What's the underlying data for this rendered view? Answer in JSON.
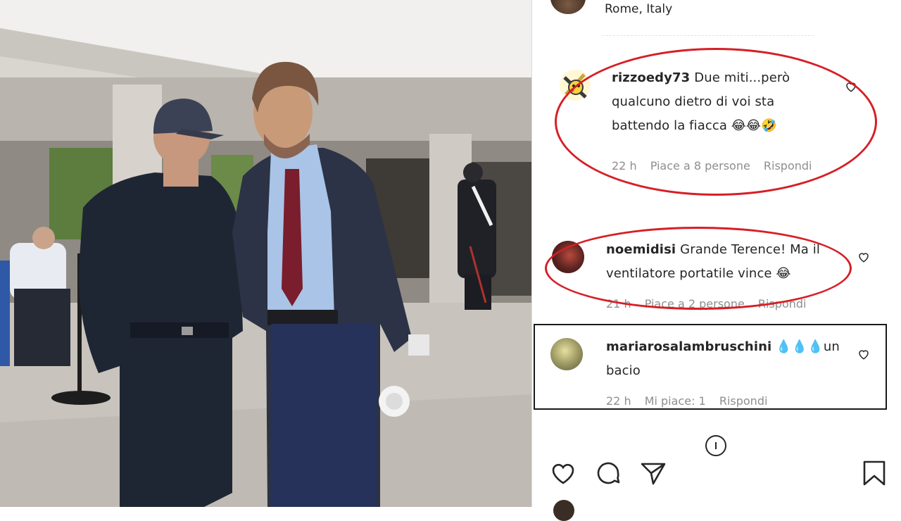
{
  "post": {
    "location": "Rome, Italy"
  },
  "comments": [
    {
      "username": "rizzoedy73",
      "text_line1": "Due miti...però",
      "text_line2": "qualcuno dietro di voi sta",
      "text_line3": "battendo la fiacca 😂😂🤣",
      "time": "22 h",
      "likes": "Piace a 8 persone",
      "reply": "Rispondi",
      "avatar_icon": "pokemon-avatar-icon"
    },
    {
      "username": "noemidisi",
      "text_line1": "Grande Terence! Ma il",
      "text_line2": "ventilatore portatile vince 😂",
      "time": "21 h",
      "likes": "Piace a 2 persone",
      "reply": "Rispondi"
    },
    {
      "username": "mariarosalambruschini",
      "text_line1": "💧💧💧un",
      "text_line2": "bacio",
      "time": "22 h",
      "likes": "Mi piace: 1",
      "reply": "Rispondi"
    }
  ],
  "colors": {
    "annotation_red": "#d61f26",
    "text_primary": "#262626",
    "text_secondary": "#8e8e8e"
  },
  "actions": [
    "heart-icon",
    "comment-icon",
    "share-icon",
    "bookmark-icon"
  ]
}
